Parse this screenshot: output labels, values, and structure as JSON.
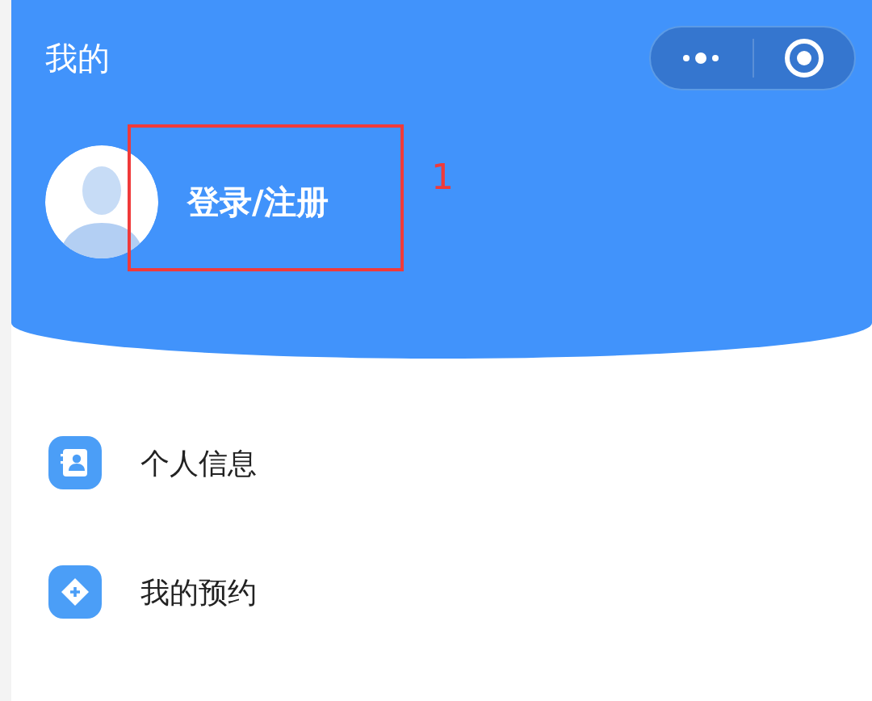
{
  "header": {
    "title": "我的",
    "login_label": "登录/注册"
  },
  "annotation": {
    "label": "1",
    "color": "#f03a3a"
  },
  "menu": [
    {
      "label": "个人信息",
      "kind": "contact"
    },
    {
      "label": "我的预约",
      "kind": "appointment"
    }
  ]
}
